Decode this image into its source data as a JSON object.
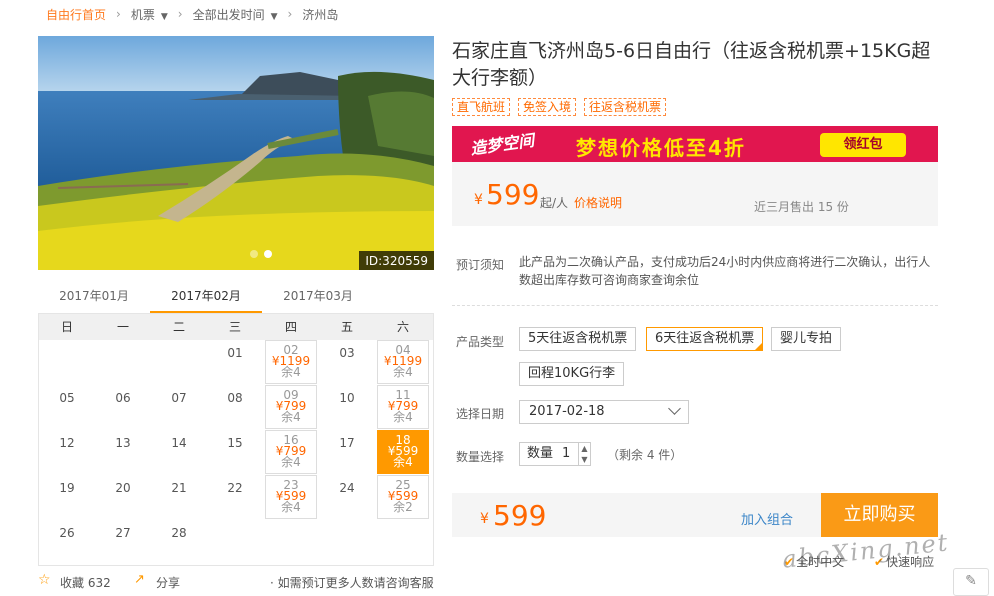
{
  "breadcrumb": {
    "home": "自由行首页",
    "flight": "机票",
    "departure": "全部出发时间",
    "destination": "济州岛"
  },
  "hero": {
    "id_tag": "ID:320559"
  },
  "calendar": {
    "months": [
      "2017年01月",
      "2017年02月",
      "2017年03月"
    ],
    "active_month": "2017年02月",
    "weekdays": [
      "日",
      "一",
      "二",
      "三",
      "四",
      "五",
      "六"
    ],
    "plain_days": [
      "01",
      "03",
      "05",
      "06",
      "07",
      "08",
      "10",
      "12",
      "13",
      "14",
      "15",
      "17",
      "19",
      "20",
      "21",
      "22",
      "24",
      "26",
      "27",
      "28"
    ],
    "priced_days": [
      {
        "day": "02",
        "price": "¥1199",
        "rest": "余4"
      },
      {
        "day": "04",
        "price": "¥1199",
        "rest": "余4"
      },
      {
        "day": "09",
        "price": "¥799",
        "rest": "余4"
      },
      {
        "day": "11",
        "price": "¥799",
        "rest": "余4"
      },
      {
        "day": "16",
        "price": "¥799",
        "rest": "余4"
      },
      {
        "day": "18",
        "price": "¥599",
        "rest": "余4"
      },
      {
        "day": "23",
        "price": "¥599",
        "rest": "余4"
      },
      {
        "day": "25",
        "price": "¥599",
        "rest": "余2"
      }
    ]
  },
  "footer": {
    "favorite": "收藏 632",
    "share": "分享",
    "advisory": "· 如需预订更多人数请咨询客服"
  },
  "product": {
    "title": "石家庄直飞济州岛5-6日自由行（往返含税机票+15KG超大行李额）",
    "tags": [
      "直飞航班",
      "免签入境",
      "往返含税机票"
    ]
  },
  "banner": {
    "brand": "造梦空间",
    "promo": "梦想价格低至4折",
    "button": "领红包"
  },
  "price": {
    "currency": "¥",
    "amount": "599",
    "per": "起/人",
    "explain": "价格说明",
    "sold": "近三月售出 15 份"
  },
  "notice": {
    "label": "预订须知",
    "text": "此产品为二次确认产品，支付成功后24小时内供应商将进行二次确认，出行人数超出库存数可咨询商家查询余位"
  },
  "options": {
    "type_label": "产品类型",
    "types": [
      "5天往返含税机票",
      "6天往返含税机票",
      "婴儿专拍",
      "回程10KG行李"
    ],
    "selected_type": "6天往返含税机票",
    "date_label": "选择日期",
    "date_value": "2017-02-18",
    "qty_label": "数量选择",
    "qty_text": "数量",
    "qty_value": "1",
    "remain": "（剩余 4 件）"
  },
  "buy": {
    "currency": "¥",
    "amount": "599",
    "combo": "加入组合",
    "button": "立即购买"
  },
  "services": [
    "全时中文",
    "快速响应"
  ],
  "watermark": "abcXing.net"
}
